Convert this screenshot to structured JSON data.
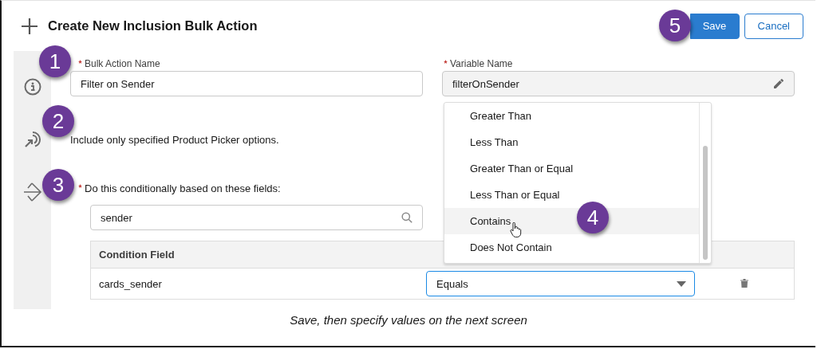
{
  "header": {
    "title": "Create New Inclusion Bulk Action",
    "buttons": [
      {
        "label": "Save",
        "kind": "primary"
      },
      {
        "label": "Cancel",
        "kind": "neutral"
      }
    ]
  },
  "fields": [
    {
      "label": "Bulk Action Name",
      "required": true,
      "value": "Filter on Sender",
      "readonly": false
    },
    {
      "label": "Variable Name",
      "required": true,
      "value": "filterOnSender",
      "readonly": true
    }
  ],
  "description": "Include only specified Product Picker options.",
  "condition": {
    "label": "Do this conditionally based on these fields:",
    "required": true,
    "search": "sender",
    "columns": [
      "Condition Field"
    ],
    "rows": [
      {
        "field": "cards_sender",
        "operator": "Equals"
      }
    ]
  },
  "dropdown": {
    "options": [
      {
        "label": "Greater Than",
        "selected": false
      },
      {
        "label": "Less Than",
        "selected": false
      },
      {
        "label": "Greater Than or Equal",
        "selected": false
      },
      {
        "label": "Less Than or Equal",
        "selected": false
      },
      {
        "label": "Contains",
        "selected": true
      },
      {
        "label": "Does Not Contain",
        "selected": false
      }
    ]
  },
  "callouts": [
    "1",
    "2",
    "3",
    "4",
    "5"
  ],
  "footer": "Save, then specify values on the next screen"
}
